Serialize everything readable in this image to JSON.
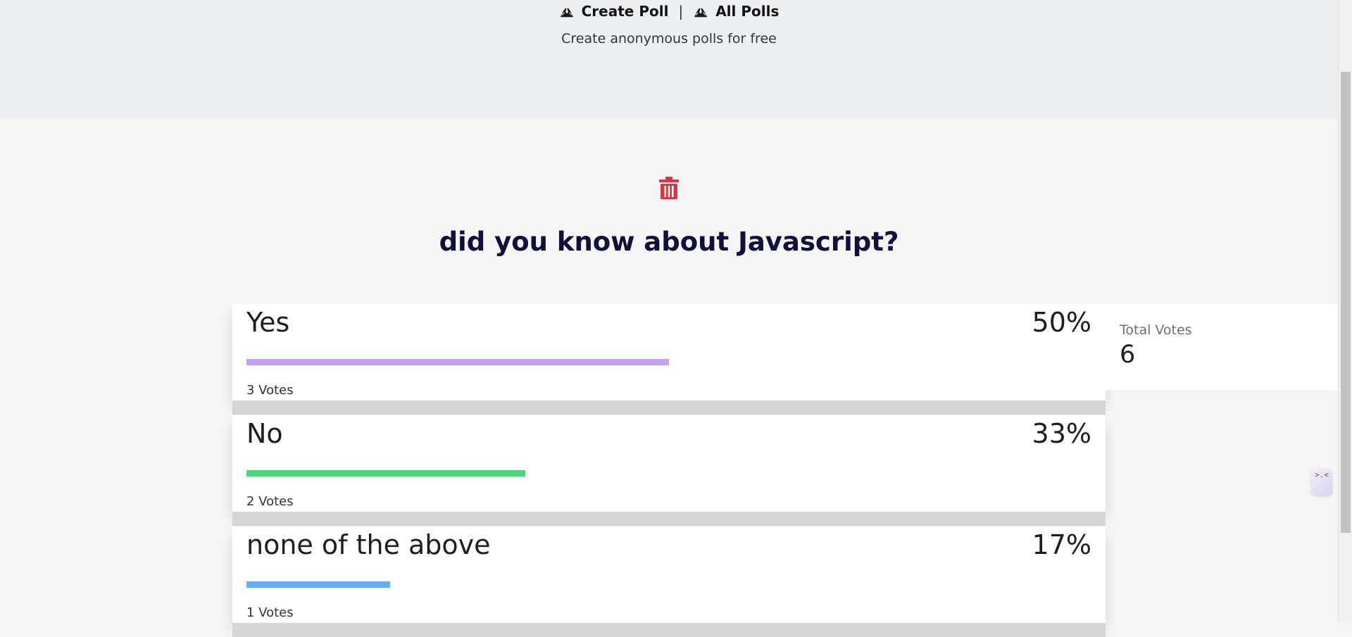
{
  "header": {
    "nav": {
      "create_poll": "Create Poll",
      "separator": "|",
      "all_polls": "All Polls"
    },
    "tagline": "Create anonymous polls for free"
  },
  "poll": {
    "title": "did you know about Javascript?",
    "options": [
      {
        "label": "Yes",
        "percent": "50%",
        "votes": "3 Votes",
        "fraction": 0.5,
        "color": "#c9a0f0"
      },
      {
        "label": "No",
        "percent": "33%",
        "votes": "2 Votes",
        "fraction": 0.33,
        "color": "#4cd67a"
      },
      {
        "label": "none of the above",
        "percent": "17%",
        "votes": "1 Votes",
        "fraction": 0.17,
        "color": "#62aef0"
      }
    ],
    "total": {
      "label": "Total Votes",
      "value": "6"
    }
  },
  "colors": {
    "delete_icon": "#dc3545",
    "title": "#101038"
  },
  "icons": {
    "nav_icon": "praying-hands-icon",
    "delete": "trash-icon",
    "widget": "chat-widget-icon"
  },
  "widget": {
    "glyph": ">.<"
  }
}
